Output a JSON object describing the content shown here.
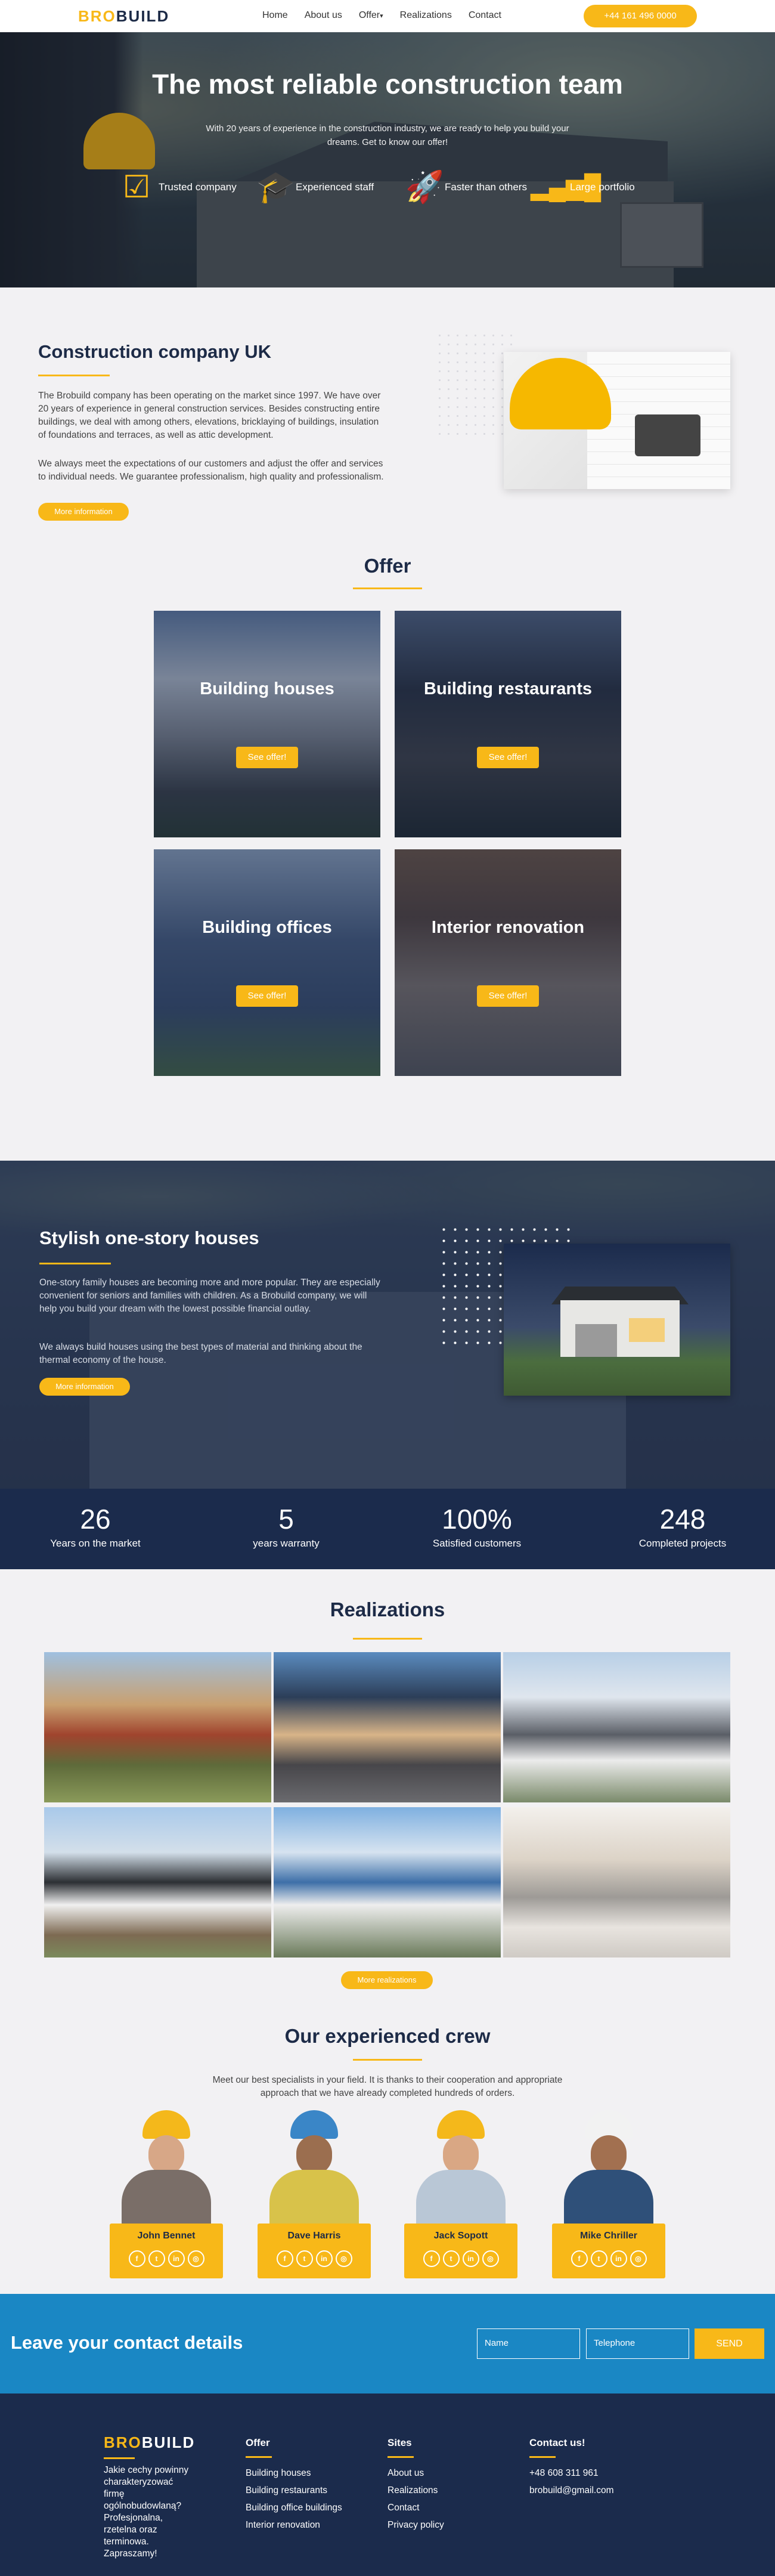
{
  "header": {
    "logo_a": "BRO",
    "logo_b": "BUILD",
    "nav": [
      "Home",
      "About us",
      "Offer",
      "Realizations",
      "Contact"
    ],
    "offer_caret": "▾",
    "phone": "+44 161 496 0000"
  },
  "hero": {
    "title": "The most reliable construction team",
    "subtitle": "With 20 years of experience in the construction industry, we are ready to help you build your dreams. Get to know our offer!",
    "features": [
      "Trusted company",
      "Experienced staff",
      "Faster than others",
      "Large portfolio"
    ]
  },
  "company": {
    "title": "Construction company UK",
    "para1": "The Brobuild company has been operating on the market since 1997. We have over 20 years of experience in general construction services. Besides constructing entire buildings, we deal with among others, elevations, bricklaying of buildings, insulation of foundations and terraces, as well as attic development.",
    "para2": "We always meet the expectations of our customers and adjust the offer and services to individual needs. We guarantee professionalism, high quality and professionalism.",
    "button": "More information"
  },
  "offer": {
    "title": "Offer",
    "cards": [
      {
        "title": "Building houses",
        "button": "See offer!"
      },
      {
        "title": "Building restaurants",
        "button": "See offer!"
      },
      {
        "title": "Building offices",
        "button": "See offer!"
      },
      {
        "title": "Interior renovation",
        "button": "See offer!"
      }
    ]
  },
  "stylish": {
    "title": "Stylish one-story houses",
    "para1": "One-story family houses are becoming more and more popular. They are especially convenient for seniors and families with children. As a Brobuild company, we will help you build your dream with the lowest possible financial outlay.",
    "para2": "We always build houses using the best types of material and thinking about the thermal economy of the house.",
    "button": "More information"
  },
  "stats": [
    {
      "number": "26",
      "label": "Years on the market"
    },
    {
      "number": "5",
      "label": "years warranty"
    },
    {
      "number": "100%",
      "label": "Satisfied customers"
    },
    {
      "number": "248",
      "label": "Completed projects"
    }
  ],
  "realizations": {
    "title": "Realizations",
    "button": "More realizations"
  },
  "crew": {
    "title": "Our experienced crew",
    "subtitle": "Meet our best specialists in your field. It is thanks to their cooperation and appropriate approach that we have already completed hundreds of orders.",
    "members": [
      "John Bennet",
      "Dave Harris",
      "Jack Sopott",
      "Mike Chriller"
    ],
    "social": [
      "f",
      "t",
      "in",
      "◎"
    ]
  },
  "contact": {
    "title": "Leave your contact details",
    "name_placeholder": "Name",
    "phone_placeholder": "Telephone",
    "send": "SEND"
  },
  "footer": {
    "logo_a": "BRO",
    "logo_b": "BUILD",
    "tagline": "Jakie cechy powinny charakteryzować firmę ogólnobudowlaną? Profesjonalna, rzetelna oraz terminowa. Zapraszamy!",
    "offer_title": "Offer",
    "offer_links": [
      "Building houses",
      "Building restaurants",
      "Building office buildings",
      "Interior renovation"
    ],
    "sites_title": "Sites",
    "sites_links": [
      "About us",
      "Realizations",
      "Contact",
      "Privacy policy"
    ],
    "contact_title": "Contact us!",
    "contact_lines": [
      "+48 608 311 961",
      "brobuild@gmail.com"
    ]
  },
  "colors": {
    "accent": "#f8b818",
    "navy": "#1b2b4c",
    "contact_blue": "#1a87c4"
  }
}
